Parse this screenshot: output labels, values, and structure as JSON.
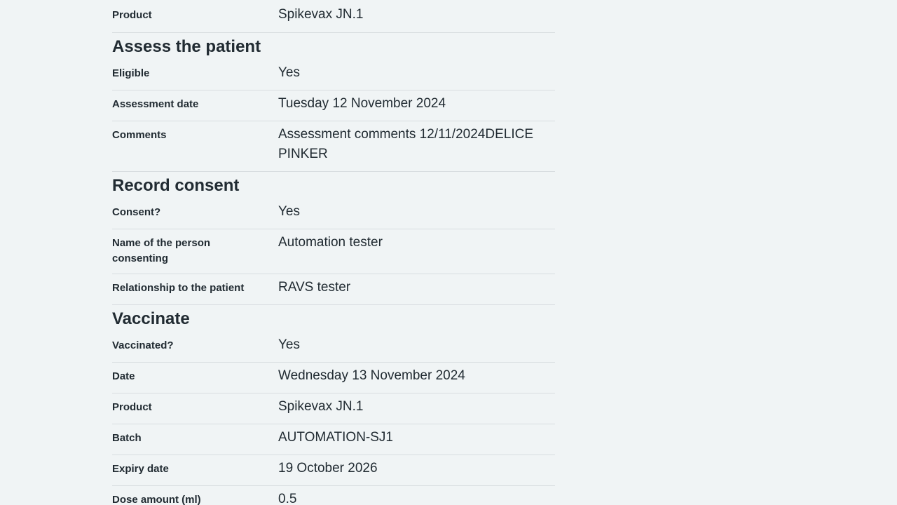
{
  "top_section": {
    "rows": [
      {
        "key": "Product",
        "value": "Spikevax JN.1"
      }
    ]
  },
  "assess": {
    "heading": "Assess the patient",
    "rows": [
      {
        "key": "Eligible",
        "value": "Yes"
      },
      {
        "key": "Assessment date",
        "value": "Tuesday 12 November 2024"
      },
      {
        "key": "Comments",
        "value": "Assessment comments 12/11/2024DELICE PINKER"
      }
    ]
  },
  "consent": {
    "heading": "Record consent",
    "rows": [
      {
        "key": "Consent?",
        "value": "Yes"
      },
      {
        "key": "Name of the person consenting",
        "value": "Automation tester"
      },
      {
        "key": "Relationship to the patient",
        "value": "RAVS tester"
      }
    ]
  },
  "vaccinate": {
    "heading": "Vaccinate",
    "rows": [
      {
        "key": "Vaccinated?",
        "value": "Yes"
      },
      {
        "key": "Date",
        "value": "Wednesday 13 November 2024"
      },
      {
        "key": "Product",
        "value": "Spikevax JN.1"
      },
      {
        "key": "Batch",
        "value": "AUTOMATION-SJ1"
      },
      {
        "key": "Expiry date",
        "value": "19 October 2026"
      },
      {
        "key": "Dose amount (ml)",
        "value": "0.5"
      }
    ]
  }
}
